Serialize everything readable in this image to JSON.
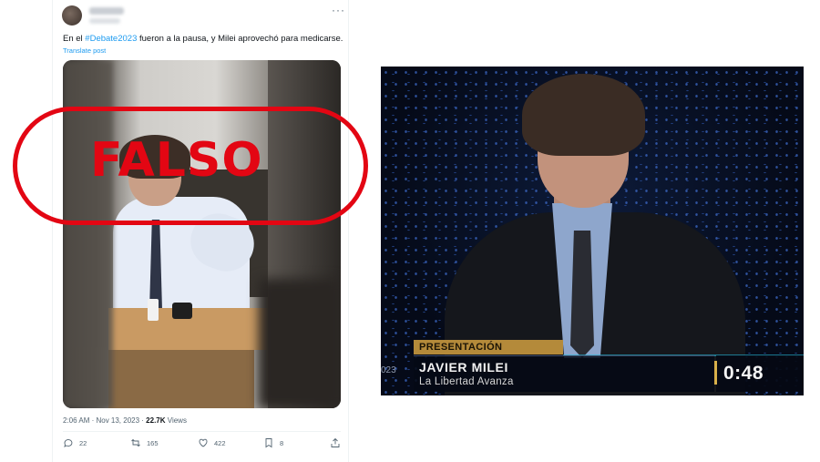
{
  "tweet": {
    "text_prefix": "En el ",
    "hashtag": "#Debate2023",
    "text_suffix": " fueron a la pausa, y Milei aprovechó para medicarse.",
    "translate_label": "Translate post",
    "more_label": "···",
    "time_date": "2:06 AM · Nov 13, 2023 · ",
    "views_count": "22.7K",
    "views_label": " Views",
    "actions": {
      "replies": "22",
      "reposts": "165",
      "likes": "422",
      "bookmarks": "8"
    }
  },
  "stamp": {
    "label": "FALSO",
    "color": "#e30613"
  },
  "video": {
    "segment_label": "PRESENTACIÓN",
    "speaker_name": "JAVIER MILEI",
    "speaker_party": "La Libertad Avanza",
    "year_fragment": "023",
    "timer": "0:48"
  },
  "colors": {
    "link": "#1d9bf0",
    "text": "#0f1419",
    "muted": "#536471",
    "accent_gold": "#b48a3a"
  },
  "icons": [
    "more-icon",
    "reply-icon",
    "repost-icon",
    "like-icon",
    "bookmark-icon",
    "share-icon"
  ]
}
